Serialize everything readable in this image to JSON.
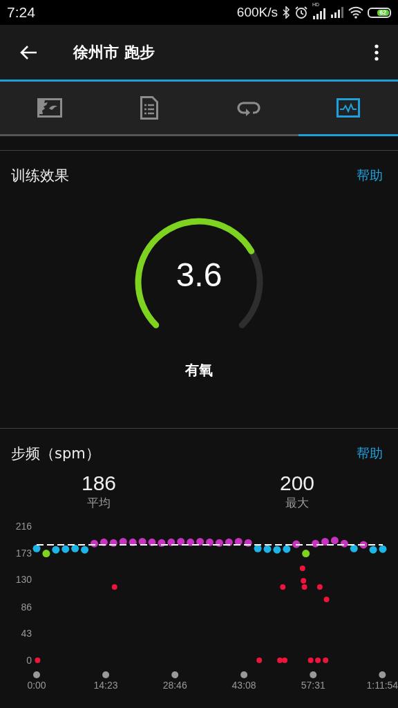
{
  "status_bar": {
    "time": "7:24",
    "speed": "600K/s",
    "hd": "HD",
    "battery": "62"
  },
  "app_bar": {
    "title": "徐州市 跑步"
  },
  "tabs": [
    {
      "kind": "map",
      "selected": false
    },
    {
      "kind": "details",
      "selected": false
    },
    {
      "kind": "laps",
      "selected": false
    },
    {
      "kind": "chart",
      "selected": true
    }
  ],
  "training_effect": {
    "title": "训练效果",
    "help": "帮助",
    "value": "3.6",
    "label": "有氧"
  },
  "cadence": {
    "title": "步频（spm）",
    "help": "帮助",
    "stats": [
      {
        "value": "186",
        "label": "平均"
      },
      {
        "value": "200",
        "label": "最大"
      }
    ],
    "chart_data": {
      "type": "scatter",
      "x": [
        0,
        0.2,
        2,
        4,
        6,
        8,
        10,
        12,
        14,
        16,
        16.2,
        18,
        20,
        22,
        24,
        26,
        28,
        30,
        32,
        34,
        36,
        38,
        40,
        42,
        44,
        46,
        46.3,
        48,
        50,
        50.6,
        51.2,
        51.6,
        52,
        54,
        55.3,
        55.5,
        55.7,
        56,
        57,
        58,
        58.5,
        58.9,
        60,
        60.1,
        60.3,
        62,
        64,
        66,
        68,
        70,
        72
      ],
      "series": [
        {
          "color": "#c832c0",
          "values": [
            null,
            null,
            null,
            null,
            null,
            null,
            null,
            188,
            190,
            189,
            null,
            191,
            190,
            191,
            190,
            189,
            190,
            191,
            190,
            191,
            190,
            189,
            190,
            191,
            189,
            null,
            null,
            null,
            null,
            null,
            null,
            null,
            null,
            187,
            null,
            null,
            null,
            null,
            null,
            188,
            null,
            null,
            191,
            null,
            null,
            193,
            188,
            null,
            186,
            null,
            null
          ]
        },
        {
          "color": "#1eb4e6",
          "values": [
            180,
            null,
            null,
            178,
            179,
            180,
            178,
            null,
            null,
            null,
            null,
            null,
            null,
            null,
            null,
            null,
            null,
            null,
            null,
            null,
            null,
            null,
            null,
            null,
            null,
            180,
            null,
            179,
            178,
            null,
            null,
            null,
            179,
            null,
            null,
            null,
            null,
            null,
            null,
            null,
            null,
            null,
            null,
            null,
            null,
            null,
            null,
            180,
            null,
            178,
            179
          ]
        },
        {
          "color": "#7ed321",
          "values": [
            null,
            null,
            172,
            null,
            null,
            null,
            null,
            null,
            null,
            null,
            null,
            null,
            null,
            null,
            null,
            null,
            null,
            null,
            null,
            null,
            null,
            null,
            null,
            null,
            null,
            null,
            null,
            null,
            null,
            null,
            null,
            null,
            null,
            null,
            null,
            null,
            null,
            172,
            null,
            null,
            null,
            null,
            null,
            null,
            null,
            null,
            null,
            null,
            null,
            null,
            null
          ]
        },
        {
          "color": "#f0143c",
          "values": [
            null,
            0,
            null,
            null,
            null,
            null,
            null,
            null,
            null,
            null,
            118,
            null,
            null,
            null,
            null,
            null,
            null,
            null,
            null,
            null,
            null,
            null,
            null,
            null,
            null,
            null,
            0,
            null,
            null,
            0,
            118,
            0,
            null,
            null,
            148,
            128,
            118,
            null,
            0,
            null,
            0,
            118,
            null,
            0,
            98,
            null,
            null,
            null,
            null,
            null,
            null
          ]
        }
      ],
      "xlim": [
        0,
        72
      ],
      "ylim": [
        0,
        216
      ],
      "yticks": [
        0,
        43,
        86,
        130,
        173,
        216
      ],
      "xticks": [
        {
          "value": 0,
          "label": "0:00"
        },
        {
          "value": 14.38,
          "label": "14:23"
        },
        {
          "value": 28.77,
          "label": "28:46"
        },
        {
          "value": 43.13,
          "label": "43:08"
        },
        {
          "value": 57.52,
          "label": "57:31"
        },
        {
          "value": 71.9,
          "label": "1:11:54"
        }
      ],
      "ref_lines": [
        {
          "axis": "y",
          "value": 186
        }
      ]
    }
  }
}
